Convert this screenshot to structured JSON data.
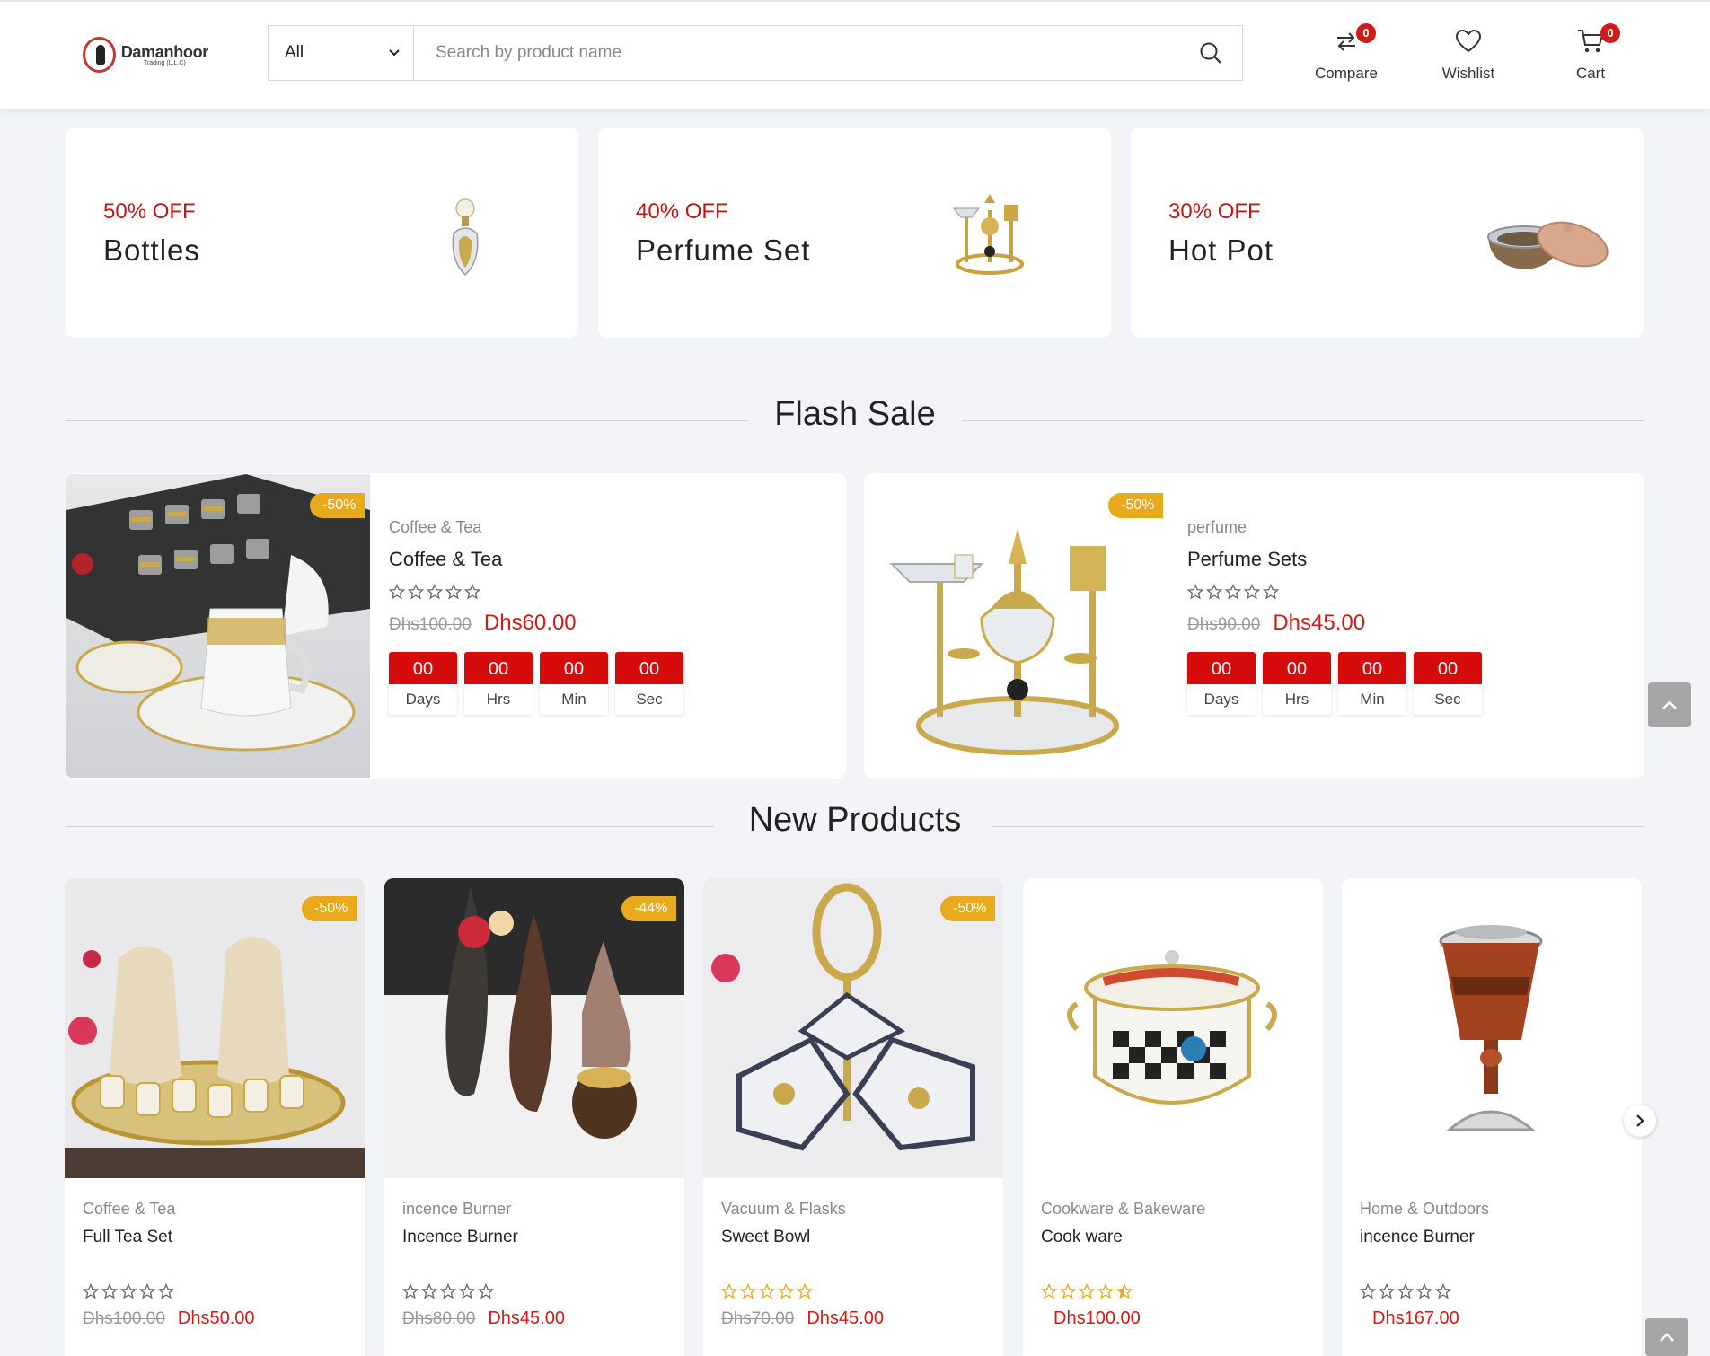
{
  "header": {
    "logo_name": "Damanhoor",
    "logo_sub": "Trading (L.L.C)",
    "category_selected": "All",
    "search_placeholder": "Search by product name",
    "compare": {
      "label": "Compare",
      "count": "0"
    },
    "wishlist": {
      "label": "Wishlist"
    },
    "cart": {
      "label": "Cart",
      "count": "0"
    }
  },
  "banners": [
    {
      "off": "50% OFF",
      "title": "Bottles"
    },
    {
      "off": "40% OFF",
      "title": "Perfume Set"
    },
    {
      "off": "30% OFF",
      "title": "Hot Pot"
    }
  ],
  "sections": {
    "flash": "Flash Sale",
    "new": "New Products"
  },
  "flash_sale": [
    {
      "discount": "-50%",
      "category": "Coffee & Tea",
      "name": "Coffee & Tea",
      "old_price": "Dhs100.00",
      "price": "Dhs60.00",
      "timer": [
        {
          "num": "00",
          "unit": "Days"
        },
        {
          "num": "00",
          "unit": "Hrs"
        },
        {
          "num": "00",
          "unit": "Min"
        },
        {
          "num": "00",
          "unit": "Sec"
        }
      ]
    },
    {
      "discount": "-50%",
      "category": "perfume",
      "name": "Perfume Sets",
      "old_price": "Dhs90.00",
      "price": "Dhs45.00",
      "timer": [
        {
          "num": "00",
          "unit": "Days"
        },
        {
          "num": "00",
          "unit": "Hrs"
        },
        {
          "num": "00",
          "unit": "Min"
        },
        {
          "num": "00",
          "unit": "Sec"
        }
      ]
    }
  ],
  "new_products": [
    {
      "discount": "-50%",
      "category": "Coffee & Tea",
      "name": "Full Tea Set",
      "old_price": "Dhs100.00",
      "price": "Dhs50.00",
      "rating": 0
    },
    {
      "discount": "-44%",
      "category": "incence Burner",
      "name": "Incence Burner",
      "old_price": "Dhs80.00",
      "price": "Dhs45.00",
      "rating": 0
    },
    {
      "discount": "-50%",
      "category": "Vacuum & Flasks",
      "name": "Sweet Bowl",
      "old_price": "Dhs70.00",
      "price": "Dhs45.00",
      "rating": 5
    },
    {
      "discount": "",
      "category": "Cookware & Bakeware",
      "name": "Cook ware",
      "old_price": "",
      "price": "Dhs100.00",
      "rating": 4.5
    },
    {
      "discount": "",
      "category": "Home & Outdoors",
      "name": "incence Burner",
      "old_price": "",
      "price": "Dhs167.00",
      "rating": 0
    }
  ],
  "colors": {
    "accent_red": "#d11a1a",
    "badge_gold": "#e8a91a",
    "star_gold": "#e8a91a"
  }
}
